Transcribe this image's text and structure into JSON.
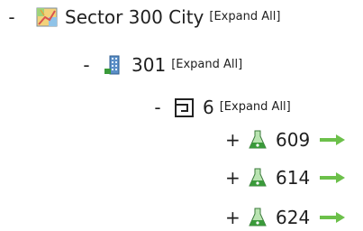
{
  "tree": {
    "root": {
      "toggle": "-",
      "label": "Sector 300 City",
      "expand_all": "[Expand All]",
      "icon": "map-icon"
    },
    "building": {
      "toggle": "-",
      "label": "301",
      "expand_all": "[Expand All]",
      "icon": "building-icon"
    },
    "floor": {
      "toggle": "-",
      "label": "6",
      "expand_all": "[Expand All]",
      "icon": "floor-plan-icon"
    },
    "rooms": [
      {
        "toggle": "+",
        "label": "609",
        "icon": "flask-icon",
        "arrow": "green-arrow-icon"
      },
      {
        "toggle": "+",
        "label": "614",
        "icon": "flask-icon",
        "arrow": "green-arrow-icon"
      },
      {
        "toggle": "+",
        "label": "624",
        "icon": "flask-icon",
        "arrow": "green-arrow-icon"
      }
    ]
  },
  "colors": {
    "arrow_green": "#6cc04a",
    "flask_green": "#3a9a3a",
    "map_orange": "#e8a23a"
  }
}
